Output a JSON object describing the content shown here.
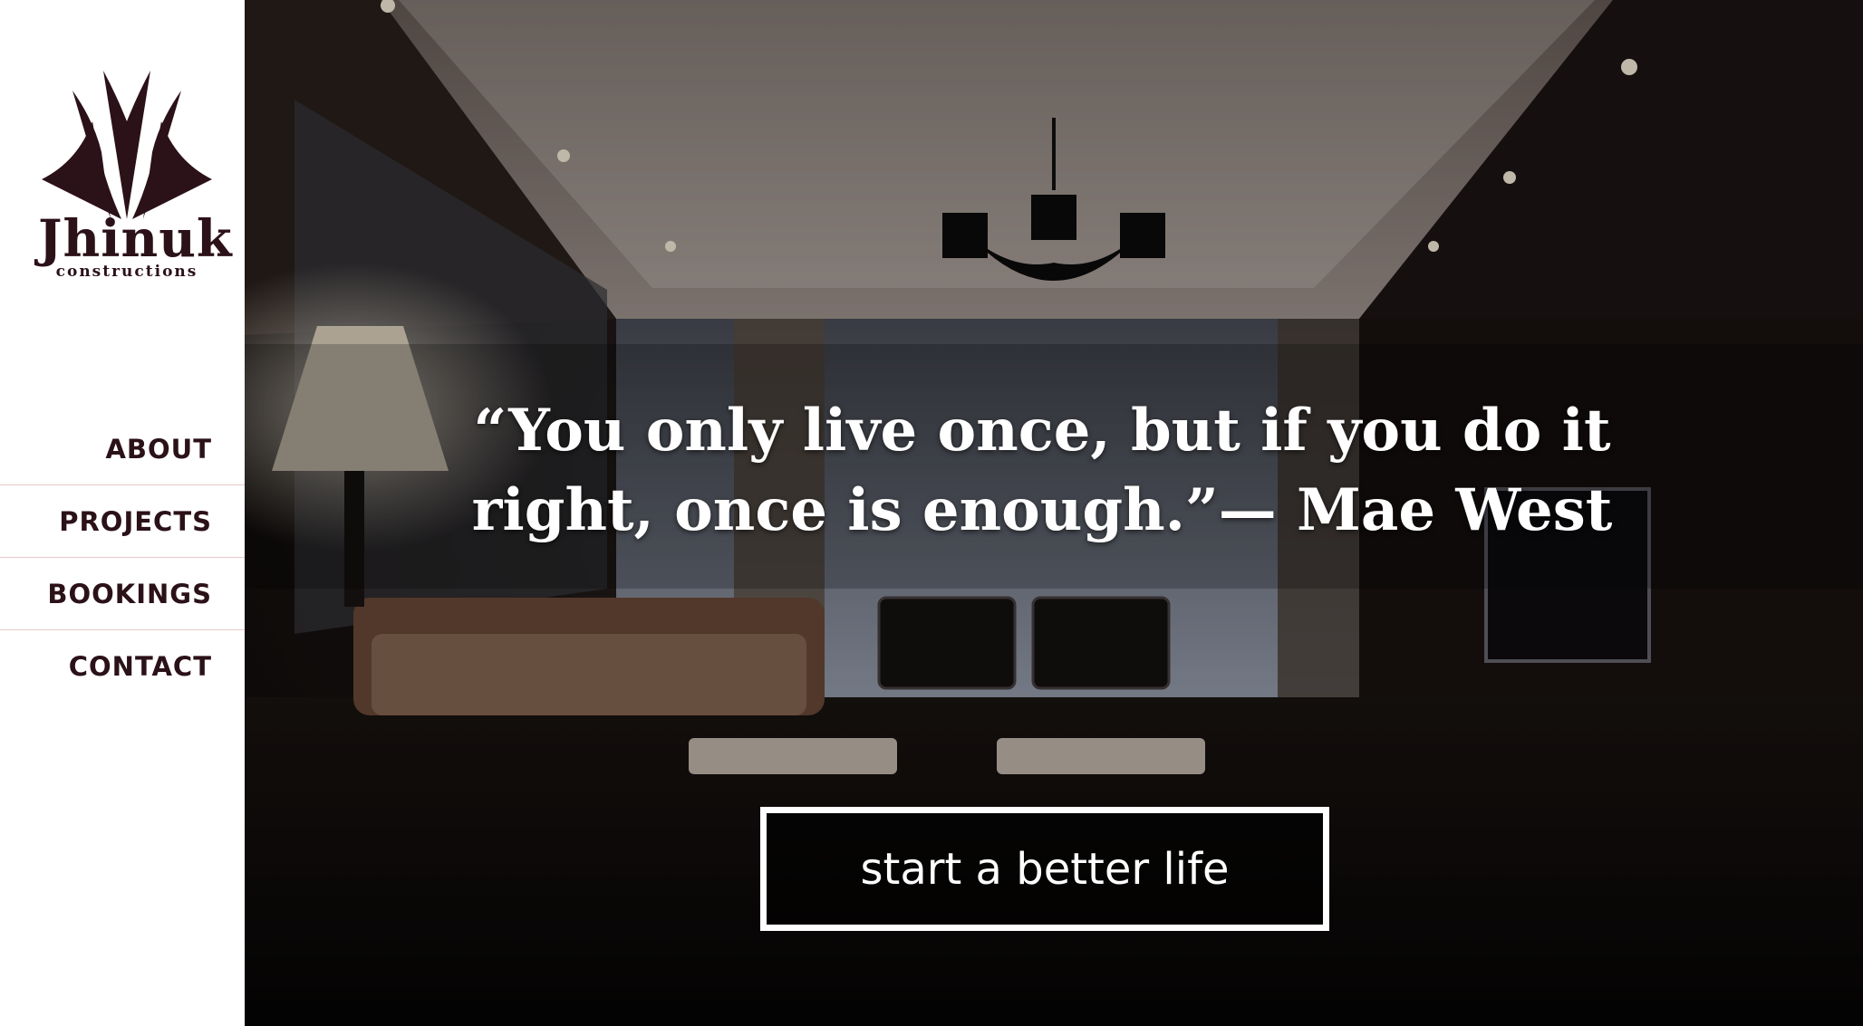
{
  "brand": {
    "name": "Jhinuk",
    "tagline": "constructions",
    "color": "#2b1118"
  },
  "nav": {
    "items": [
      {
        "label": "ABOUT"
      },
      {
        "label": "PROJECTS"
      },
      {
        "label": "BOOKINGS"
      },
      {
        "label": "CONTACT"
      }
    ]
  },
  "hero": {
    "quote": "“You only live once, but if you do it right, once is enough.”— Mae West",
    "cta_label": "start a better life",
    "background": "dim-living-room-interior-photo"
  }
}
